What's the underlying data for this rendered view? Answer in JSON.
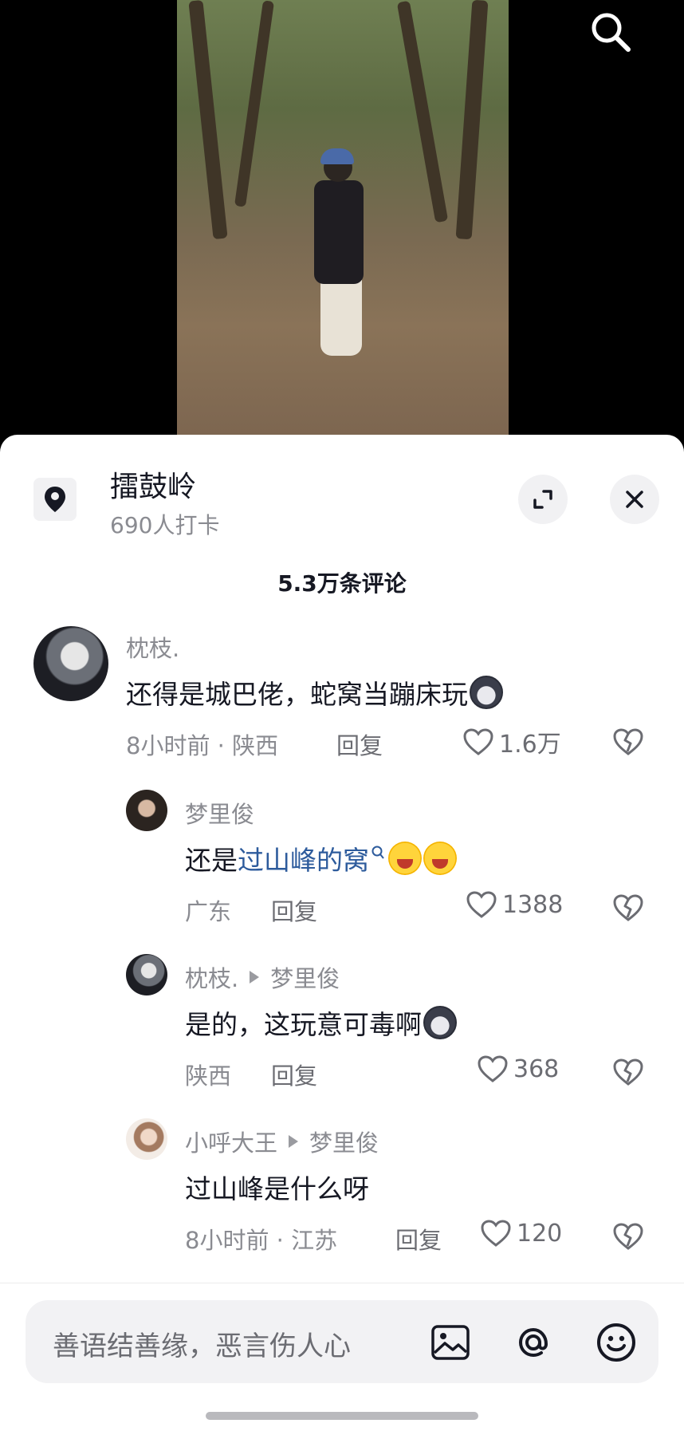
{
  "location": {
    "title": "擂鼓岭",
    "subtitle": "690人打卡"
  },
  "comments_header": "5.3万条评论",
  "comments": [
    {
      "name": "枕枝.",
      "text": "还得是城巴佬，蛇窝当蹦床玩",
      "meta": "8小时前 · 陕西",
      "reply": "回复",
      "likes": "1.6万",
      "emoji": "wolf-emoji"
    },
    {
      "name": "梦里俊",
      "text_prefix": "还是",
      "text_link": "过山峰的窝",
      "meta": "广东",
      "reply": "回复",
      "likes": "1388",
      "emoji": "laugh-cry-emoji"
    },
    {
      "name": "枕枝.",
      "reply_to": "梦里俊",
      "text": "是的，这玩意可毒啊",
      "meta": "陕西",
      "reply": "回复",
      "likes": "368",
      "emoji": "wolf-emoji"
    },
    {
      "name": "小呼大王",
      "reply_to": "梦里俊",
      "text": "过山峰是什么呀",
      "meta": "8小时前 · 江苏",
      "reply": "回复",
      "likes": "120"
    }
  ],
  "input": {
    "placeholder": "善语结善缘，恶言伤人心"
  },
  "icons": {
    "search": "search-icon",
    "location": "location-pin-icon",
    "expand": "expand-icon",
    "close": "close-icon",
    "like": "heart-icon",
    "dislike": "broken-heart-icon",
    "image": "image-icon",
    "mention": "at-icon",
    "emoji": "smiley-icon"
  }
}
